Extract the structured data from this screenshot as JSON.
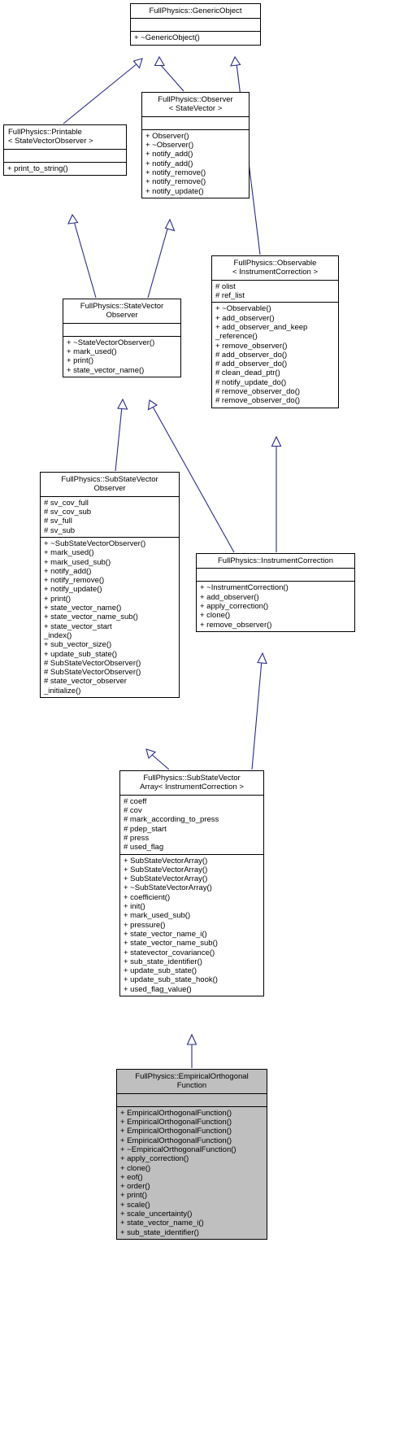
{
  "diagram": {
    "kind": "uml-class-inheritance",
    "title": "FullPhysics::EmpiricalOrthogonalFunction inheritance graph",
    "edge_color": "#2a2a8c",
    "node_border_color": "#000000",
    "node_fill_color": "#ffffff",
    "highlight_fill_color": "#bfbfbf"
  },
  "nodes": [
    {
      "id": "generic_object",
      "title": "FullPhysics::GenericObject",
      "attributes": [],
      "operations": [
        "+ ~GenericObject()"
      ],
      "highlighted": false
    },
    {
      "id": "observer_statevector",
      "title": "FullPhysics::Observer\n< StateVector >",
      "attributes": [],
      "operations": [
        "+ Observer()",
        "+ ~Observer()",
        "+ notify_add()",
        "+ notify_add()",
        "+ notify_remove()",
        "+ notify_remove()",
        "+ notify_update()"
      ],
      "highlighted": false
    },
    {
      "id": "printable_svo",
      "title": "FullPhysics::Printable\n< StateVectorObserver >",
      "attributes": [],
      "operations": [
        "+ print_to_string()"
      ],
      "highlighted": false
    },
    {
      "id": "observable_ic",
      "title": "FullPhysics::Observable\n< InstrumentCorrection >",
      "attributes": [
        "# olist",
        "# ref_list"
      ],
      "operations": [
        "+ ~Observable()",
        "+ add_observer()",
        "+ add_observer_and_keep\n_reference()",
        "+ remove_observer()",
        "# add_observer_do()",
        "# add_observer_do()",
        "# clean_dead_ptr()",
        "# notify_update_do()",
        "# remove_observer_do()",
        "# remove_observer_do()"
      ],
      "highlighted": false
    },
    {
      "id": "state_vector_observer",
      "title": "FullPhysics::StateVector\nObserver",
      "attributes": [],
      "operations": [
        "+ ~StateVectorObserver()",
        "+ mark_used()",
        "+ print()",
        "+ state_vector_name()"
      ],
      "highlighted": false
    },
    {
      "id": "sub_state_vector_observer",
      "title": "FullPhysics::SubStateVector\nObserver",
      "attributes": [
        "# sv_cov_full",
        "# sv_cov_sub",
        "# sv_full",
        "# sv_sub"
      ],
      "operations": [
        "+ ~SubStateVectorObserver()",
        "+ mark_used()",
        "+ mark_used_sub()",
        "+ notify_add()",
        "+ notify_remove()",
        "+ notify_update()",
        "+ print()",
        "+ state_vector_name()",
        "+ state_vector_name_sub()",
        "+ state_vector_start\n_index()",
        "+ sub_vector_size()",
        "+ update_sub_state()",
        "# SubStateVectorObserver()",
        "# SubStateVectorObserver()",
        "# state_vector_observer\n_initialize()"
      ],
      "highlighted": false
    },
    {
      "id": "instrument_correction",
      "title": "FullPhysics::InstrumentCorrection",
      "attributes": [],
      "operations": [
        "+ ~InstrumentCorrection()",
        "+ add_observer()",
        "+ apply_correction()",
        "+ clone()",
        "+ remove_observer()"
      ],
      "highlighted": false
    },
    {
      "id": "sub_state_vector_array_ic",
      "title": "FullPhysics::SubStateVector\nArray< InstrumentCorrection >",
      "attributes": [
        "# coeff",
        "# cov",
        "# mark_according_to_press",
        "# pdep_start",
        "# press",
        "# used_flag"
      ],
      "operations": [
        "+ SubStateVectorArray()",
        "+ SubStateVectorArray()",
        "+ SubStateVectorArray()",
        "+ ~SubStateVectorArray()",
        "+ coefficient()",
        "+ init()",
        "+ mark_used_sub()",
        "+ pressure()",
        "+ state_vector_name_i()",
        "+ state_vector_name_sub()",
        "+ statevector_covariance()",
        "+ sub_state_identifier()",
        "+ update_sub_state()",
        "+ update_sub_state_hook()",
        "+ used_flag_value()"
      ],
      "highlighted": false
    },
    {
      "id": "empirical_orthogonal_function",
      "title": "FullPhysics::EmpiricalOrthogonal\nFunction",
      "attributes": [],
      "operations": [
        "+ EmpiricalOrthogonalFunction()",
        "+ EmpiricalOrthogonalFunction()",
        "+ EmpiricalOrthogonalFunction()",
        "+ EmpiricalOrthogonalFunction()",
        "+ ~EmpiricalOrthogonalFunction()",
        "+ apply_correction()",
        "+ clone()",
        "+ eof()",
        "+ order()",
        "+ print()",
        "+ scale()",
        "+ scale_uncertainty()",
        "+ state_vector_name_i()",
        "+ sub_state_identifier()"
      ],
      "highlighted": true
    }
  ],
  "edges": [
    {
      "from": "observer_statevector",
      "to": "generic_object",
      "type": "inheritance"
    },
    {
      "from": "printable_svo",
      "to": "generic_object",
      "type": "inheritance"
    },
    {
      "from": "observable_ic",
      "to": "generic_object",
      "type": "inheritance"
    },
    {
      "from": "state_vector_observer",
      "to": "printable_svo",
      "type": "inheritance"
    },
    {
      "from": "state_vector_observer",
      "to": "observer_statevector",
      "type": "inheritance"
    },
    {
      "from": "sub_state_vector_observer",
      "to": "state_vector_observer",
      "type": "inheritance"
    },
    {
      "from": "instrument_correction",
      "to": "state_vector_observer",
      "type": "inheritance"
    },
    {
      "from": "instrument_correction",
      "to": "observable_ic",
      "type": "inheritance"
    },
    {
      "from": "sub_state_vector_array_ic",
      "to": "sub_state_vector_observer",
      "type": "inheritance"
    },
    {
      "from": "sub_state_vector_array_ic",
      "to": "instrument_correction",
      "type": "inheritance"
    },
    {
      "from": "empirical_orthogonal_function",
      "to": "sub_state_vector_array_ic",
      "type": "inheritance"
    }
  ]
}
